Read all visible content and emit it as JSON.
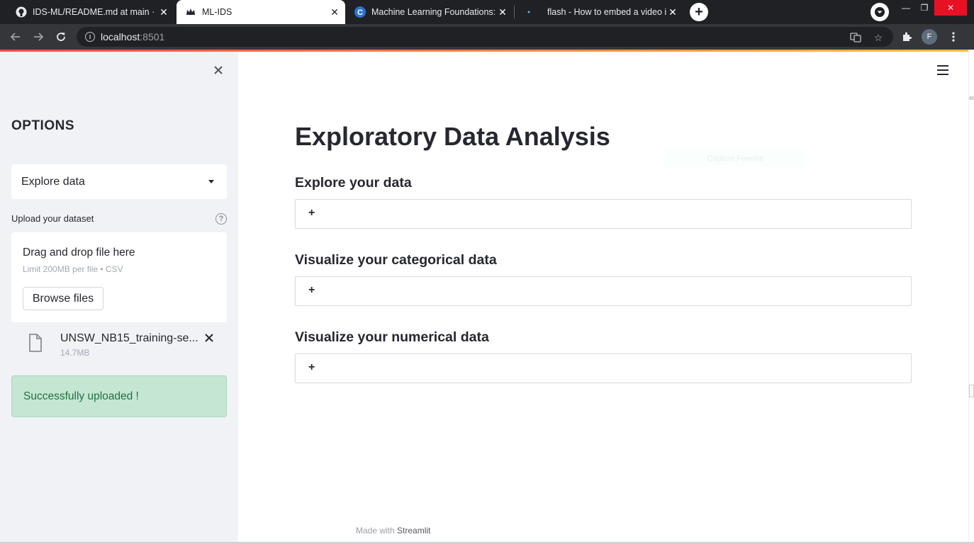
{
  "browser": {
    "tabs": [
      {
        "title": "IDS-ML/README.md at main · Br",
        "icon": "github-icon",
        "active": false
      },
      {
        "title": "ML-IDS",
        "icon": "streamlit-crown-icon",
        "active": true
      },
      {
        "title": "Machine Learning Foundations: A",
        "icon": "coursera-icon",
        "active": false
      },
      {
        "title": "flash - How to embed a video int",
        "icon": "stackoverflow-icon",
        "active": false
      }
    ],
    "url_host": "localhost",
    "url_port": ":8501",
    "profile_initial": "F"
  },
  "sidebar": {
    "title": "OPTIONS",
    "select_value": "Explore data",
    "upload_label": "Upload your dataset",
    "dropzone_title": "Drag and drop file here",
    "dropzone_limit": "Limit 200MB per file • CSV",
    "browse_label": "Browse files",
    "file_name": "UNSW_NB15_training-se...",
    "file_size": "14.7MB",
    "success_message": "Successfully uploaded !"
  },
  "main": {
    "title": "Exploratory Data Analysis",
    "overlay_text": "Capture Fenetre",
    "sections": [
      {
        "heading": "Explore your data",
        "expander_symbol": "+"
      },
      {
        "heading": "Visualize your categorical data",
        "expander_symbol": "+"
      },
      {
        "heading": "Visualize your numerical data",
        "expander_symbol": "+"
      }
    ],
    "footer_prefix": "Made with ",
    "footer_brand": "Streamlit"
  },
  "colors": {
    "sidebar_bg": "#f0f2f6",
    "success_bg": "#c5e6d3",
    "success_text": "#1e7240",
    "accent_gradient_start": "#ff4b4b",
    "accent_gradient_end": "#ffbd45"
  }
}
